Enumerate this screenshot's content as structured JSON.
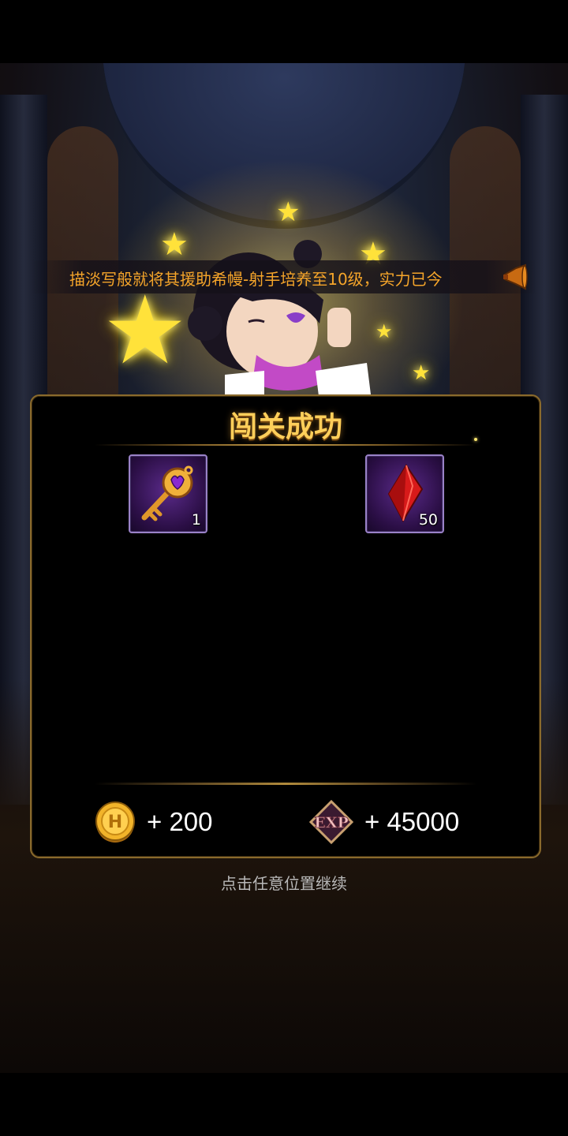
{
  "ticker": {
    "text": "描淡写般就将其援助希幔-射手培养至10级，实力已今"
  },
  "result": {
    "title": "闯关成功",
    "items": [
      {
        "name": "key",
        "icon": "golden-key-icon",
        "count": "1"
      },
      {
        "name": "crystal",
        "icon": "red-crystal-icon",
        "count": "50"
      }
    ],
    "rewards": [
      {
        "icon": "gold-coin-icon",
        "value": "+ 200"
      },
      {
        "icon": "exp-badge-icon",
        "value": "+ 45000"
      }
    ]
  },
  "hint": "点击任意位置继续",
  "colors": {
    "title": "#ffcf5a",
    "ticker": "#f5a52a",
    "frame": "#8a6a2c",
    "item_bg": "#2a0e44"
  }
}
